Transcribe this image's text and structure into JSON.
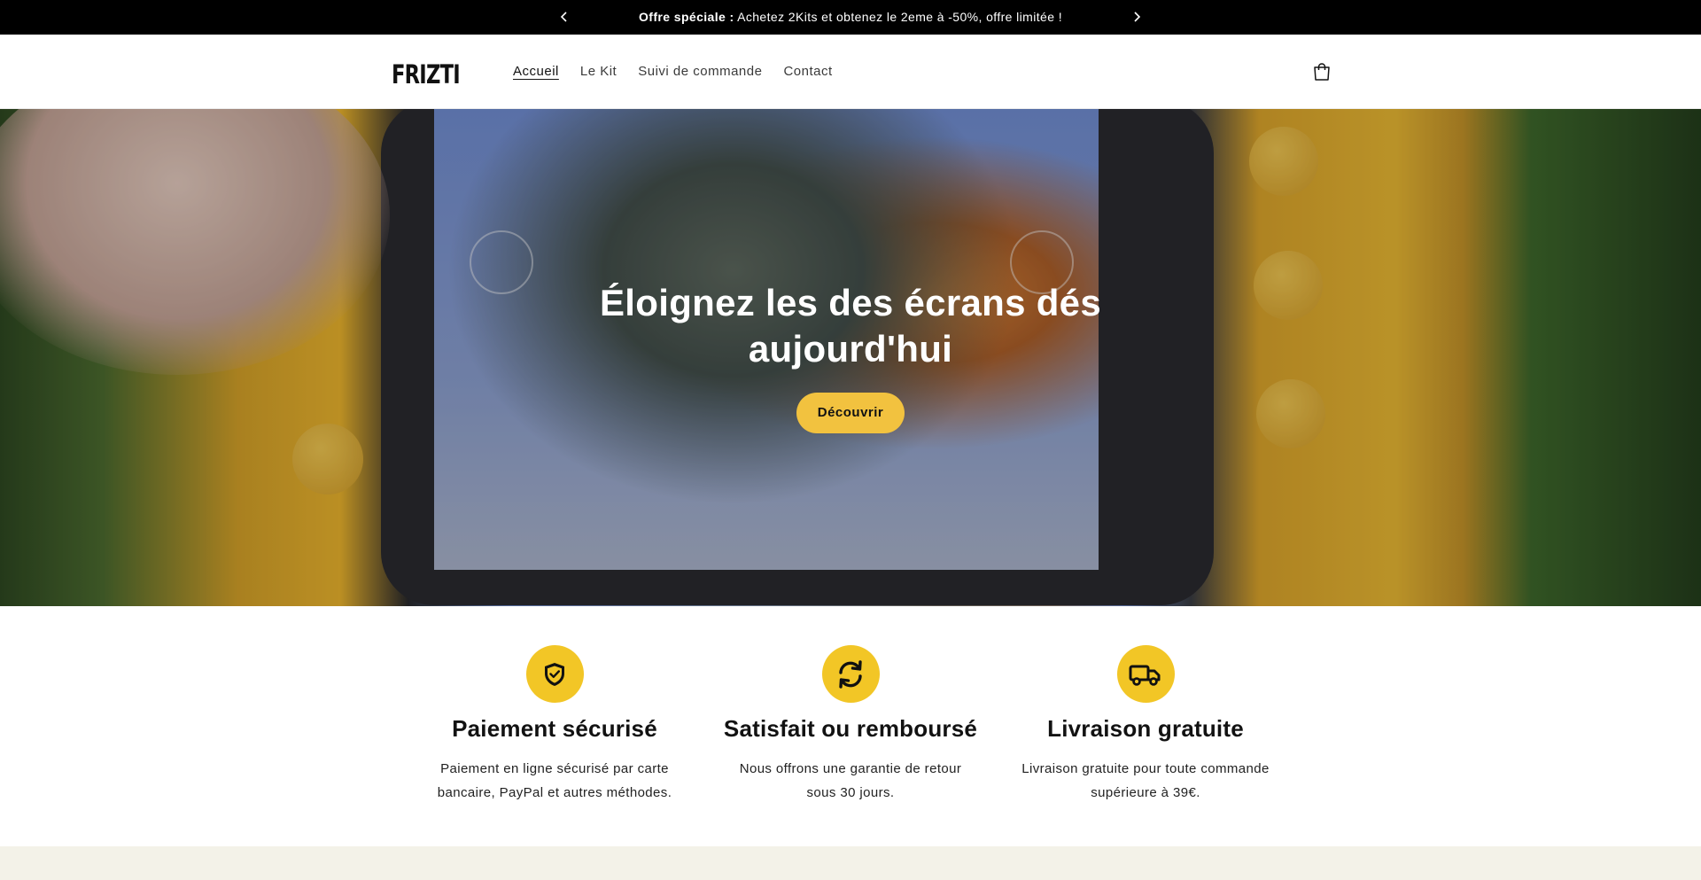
{
  "announcement": {
    "bold": "Offre spéciale :",
    "text": " Achetez 2Kits et obtenez le 2eme à -50%, offre limitée !"
  },
  "header": {
    "logo": "FRIZTI",
    "nav": [
      "Accueil",
      "Le Kit",
      "Suivi de commande",
      "Contact"
    ],
    "active_nav": "Accueil"
  },
  "hero": {
    "title_line1": "Éloignez les des écrans dés",
    "title_line2": "aujourd'hui",
    "cta": "Découvrir"
  },
  "features": [
    {
      "icon": "shield-check-icon",
      "title": "Paiement sécurisé",
      "line1": "Paiement en ligne sécurisé par carte",
      "line2": "bancaire, PayPal et autres méthodes."
    },
    {
      "icon": "refresh-icon",
      "title": "Satisfait ou remboursé",
      "line1": "Nous offrons une garantie de retour",
      "line2": "sous 30 jours."
    },
    {
      "icon": "truck-icon",
      "title": "Livraison gratuite",
      "line1": "Livraison gratuite pour toute commande",
      "line2": "supérieure à 39€."
    }
  ],
  "colors": {
    "accent": "#f2c626",
    "cta": "#f2c23f",
    "announcement_bg": "#000000",
    "beige": "#f3f2e8"
  }
}
